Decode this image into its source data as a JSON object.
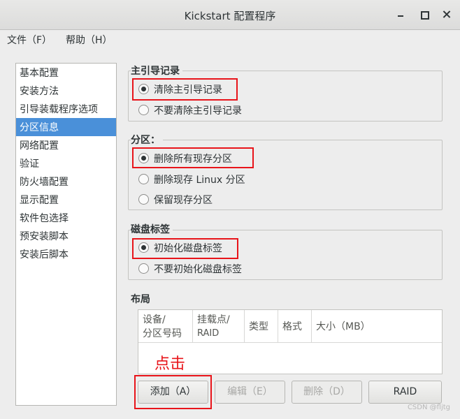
{
  "window": {
    "title": "Kickstart 配置程序"
  },
  "menu": {
    "file": "文件（F）",
    "help": "帮助（H）"
  },
  "nav": {
    "items": [
      "基本配置",
      "安装方法",
      "引导装载程序选项",
      "分区信息",
      "网络配置",
      "验证",
      "防火墙配置",
      "显示配置",
      "软件包选择",
      "预安装脚本",
      "安装后脚本"
    ],
    "selected_index": 3
  },
  "mbr": {
    "label": "主引导记录",
    "options": [
      "清除主引导记录",
      "不要清除主引导记录"
    ],
    "selected_index": 0
  },
  "partitions": {
    "label": "分区：",
    "options": [
      "删除所有现存分区",
      "删除现存 Linux 分区",
      "保留现存分区"
    ],
    "selected_index": 0
  },
  "disklabel": {
    "label": "磁盘标签",
    "options": [
      "初始化磁盘标签",
      "不要初始化磁盘标签"
    ],
    "selected_index": 0
  },
  "layout": {
    "label": "布局",
    "columns": [
      {
        "line1": "设备/",
        "line2": "分区号码"
      },
      {
        "line1": "挂载点/",
        "line2": "RAID"
      },
      {
        "line1": "类型",
        "line2": ""
      },
      {
        "line1": "格式",
        "line2": ""
      },
      {
        "line1": "大小（MB）",
        "line2": ""
      }
    ]
  },
  "annotation": {
    "text": "点击"
  },
  "buttons": {
    "add": "添加（A）",
    "edit": "编辑（E）",
    "delete": "删除（D）",
    "raid": "RAID"
  },
  "watermark": "CSDN @fljtg",
  "colors": {
    "highlight_red": "#e8141a",
    "selection_blue": "#4a90d9"
  }
}
